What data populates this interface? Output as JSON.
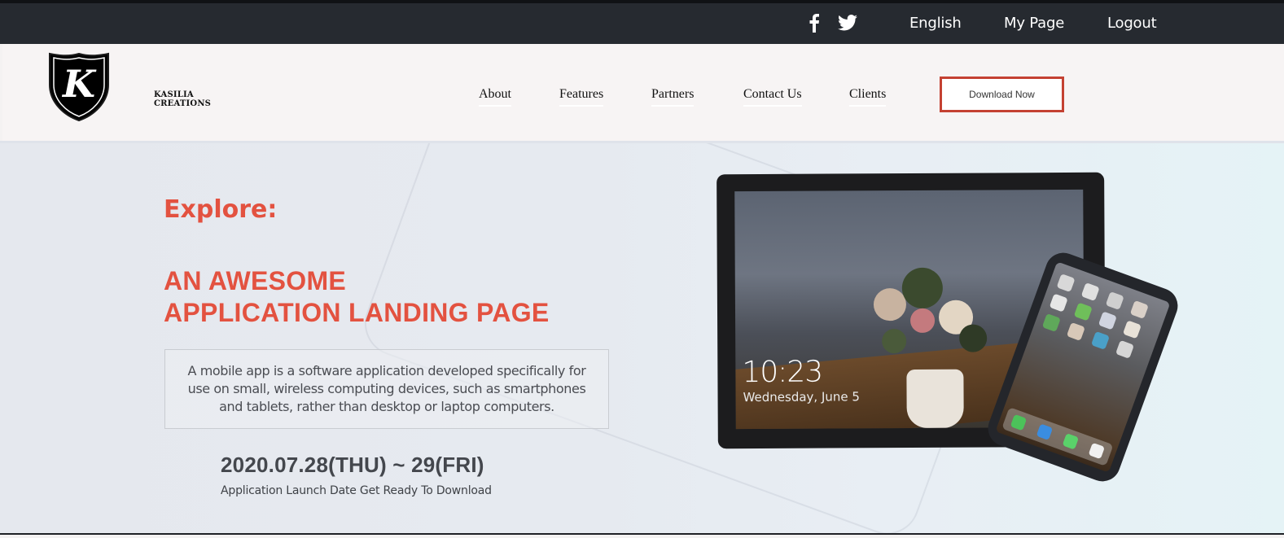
{
  "topbar": {
    "social": [
      "facebook-icon",
      "twitter-icon"
    ],
    "links": {
      "language": "English",
      "my_page": "My Page",
      "logout": "Logout"
    }
  },
  "header": {
    "logo": {
      "letter": "K",
      "brand": "KASILIA CREATIONS"
    },
    "nav": {
      "about": "About",
      "features": "Features",
      "partners": "Partners",
      "contact": "Contact Us",
      "clients": "Clients"
    },
    "download_button": "Download Now"
  },
  "hero": {
    "eyebrow": "Explore:",
    "headline_line1": "AN AWESOME",
    "headline_line2": "APPLICATION LANDING PAGE",
    "description": "A mobile app is a software application developed specifically for use on small, wireless computing devices, such as smartphones and tablets, rather than desktop or laptop computers.",
    "launch_date": "2020.07.28(THU) ~ 29(FRI)",
    "launch_caption": "Application Launch Date Get Ready To Download",
    "device_mockup": {
      "clock_time": "10:23",
      "clock_date": "Wednesday, June 5"
    }
  },
  "colors": {
    "accent": "#e35240",
    "topbar_bg": "#262a30",
    "button_border": "#c44132"
  }
}
